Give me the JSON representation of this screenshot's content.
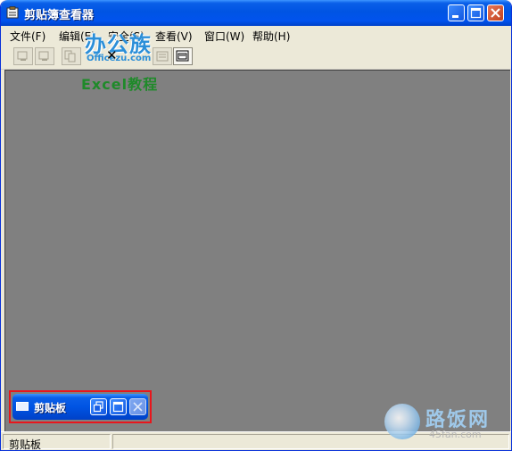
{
  "window": {
    "title": "剪贴簿查看器"
  },
  "menu": [
    "文件(F)",
    "编辑(E)",
    "安全(S)",
    "查看(V)",
    "窗口(W)",
    "帮助(H)"
  ],
  "watermark": {
    "logo": "办公族",
    "logo_sub": "Officezu.com",
    "excel": "Excel教程",
    "brand": "路饭网",
    "brand_sub": "45fan.com"
  },
  "minimized_window": {
    "title": "剪贴板"
  },
  "status": {
    "text": "剪贴板"
  },
  "colors": {
    "titlebar": "#0054e3",
    "workspace": "#808080",
    "highlight_border": "#e8161c"
  }
}
